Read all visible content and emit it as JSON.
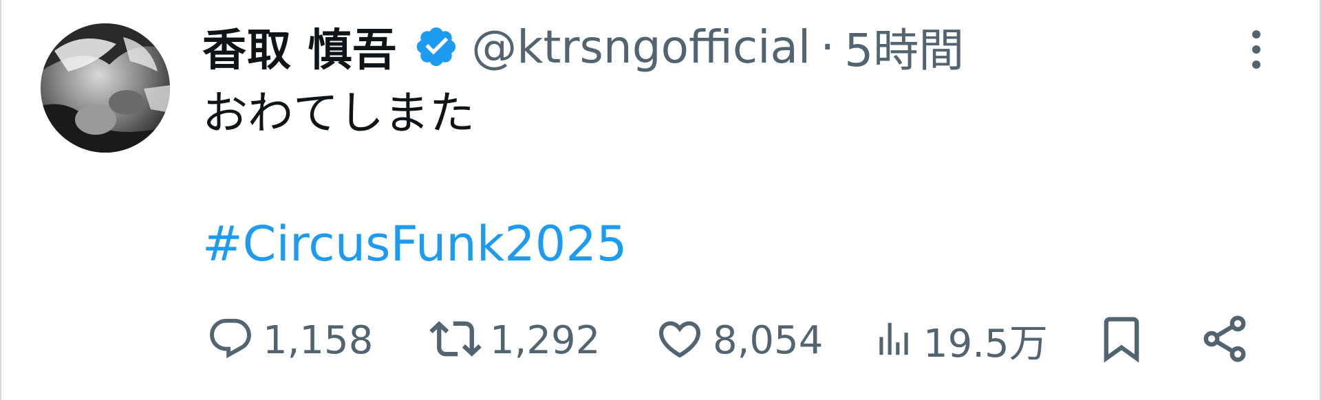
{
  "tweet": {
    "author": {
      "display_name": "香取 慎吾",
      "handle": "@ktrsngofficial",
      "verified": true
    },
    "separator": "·",
    "time": "5時間",
    "text": "おわてしまた",
    "hashtag": "#CircusFunk2025",
    "actions": {
      "replies": "1,158",
      "retweets": "1,292",
      "likes": "8,054",
      "views": "19.5万"
    }
  },
  "icons": {
    "verified": "verified-badge-icon",
    "more": "more-vertical-icon",
    "reply": "reply-icon",
    "retweet": "retweet-icon",
    "like": "heart-icon",
    "views": "views-bar-chart-icon",
    "bookmark": "bookmark-icon",
    "share": "share-icon"
  },
  "colors": {
    "text": "#0f1419",
    "secondary": "#536471",
    "accent": "#1d9bf0",
    "border": "#cfd9de"
  }
}
